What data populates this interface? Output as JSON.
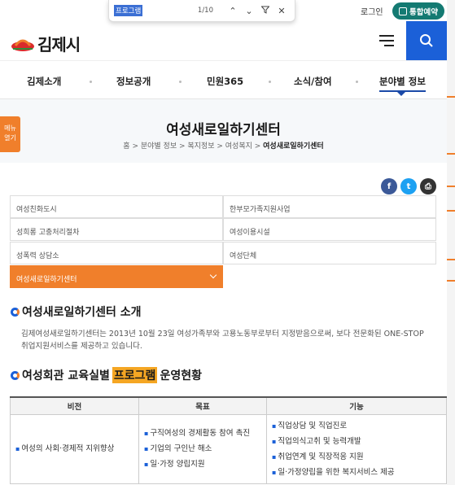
{
  "find_bar": {
    "query": "프로그램",
    "count": "1/10"
  },
  "topbar": {
    "login": "로그인",
    "reserve": "통합예약"
  },
  "logo": {
    "text": "김제시"
  },
  "gnb": [
    "김제소개",
    "정보공개",
    "민원365",
    "소식/참여",
    "분야별 정보"
  ],
  "side_menu": {
    "line1": "메뉴",
    "line2": "열기"
  },
  "page_title": "여성새로일하기센터",
  "breadcrumb": {
    "home": "홈",
    "items": [
      "분야별 정보",
      "복지정보",
      "여성복지"
    ],
    "current": "여성새로일하기센터"
  },
  "share": {
    "facebook": "f",
    "twitter": "t",
    "print": "⎙"
  },
  "submenu": [
    "여성친화도시",
    "한부모가족지원사업",
    "성희롱 고충처리절차",
    "여성이용시설",
    "성폭력 상담소",
    "여성단체",
    "여성새로일하기센터"
  ],
  "section1": {
    "title": "여성새로일하기센터 소개",
    "desc": "김제여성새로일하기센터는 2013년 10월 23일 여성가족부와 고용노동부로부터 지정받음으로써, 보다 전문화된 ONE-STOP 취업지원서비스를 제공하고 있습니다."
  },
  "section2": {
    "title_pre": "여성회관 교육실별 ",
    "title_hl": "프로그램",
    "title_post": " 운영현황"
  },
  "table": {
    "headers": [
      "비전",
      "목표",
      "기능"
    ],
    "vision": "여성의 사회·경제적 지위향상",
    "goals": [
      "구직여성의 경제활동 참여 촉진",
      "기업의 구인난 해소",
      "일·가정 양립지원"
    ],
    "functions": [
      "직업상담 및 직업진로",
      "직업의식고취 및 능력개발",
      "취업연계 및 직장적응 지원",
      "일·가정양립을 위한 복지서비스 제공"
    ]
  },
  "colors": {
    "accent": "#f07f2b",
    "primary": "#1b60d8",
    "reserve": "#147a72"
  }
}
